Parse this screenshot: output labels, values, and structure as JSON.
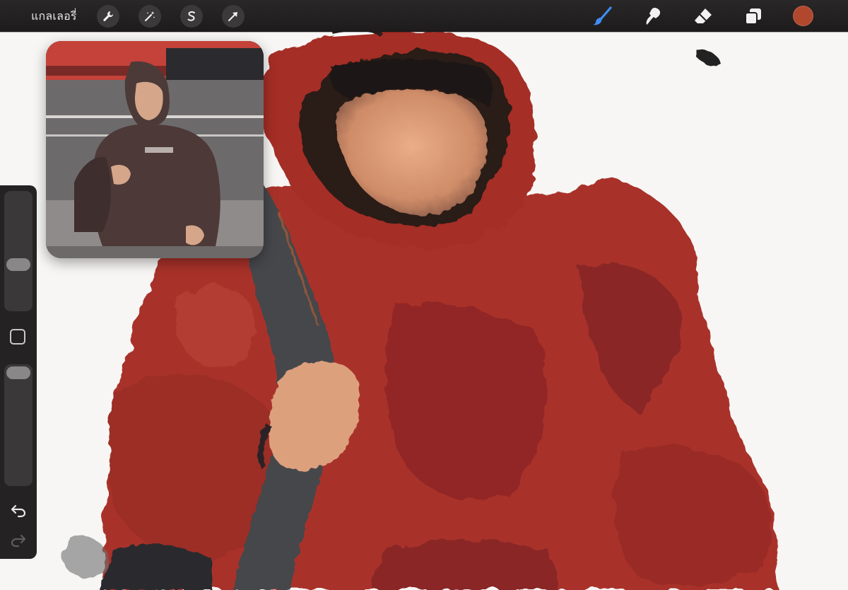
{
  "toolbar": {
    "gallery_label": "แกลเลอรี่",
    "left_tools": [
      "wrench-icon",
      "magic-wand-icon",
      "selection-s-icon",
      "transform-arrow-icon"
    ],
    "right_tools": [
      "brush-icon",
      "smudge-icon",
      "eraser-icon",
      "layers-icon"
    ],
    "active_tool": "brush-icon",
    "active_tool_color": "#3f8df5",
    "current_color": "#b1482e"
  },
  "sidebar": {
    "brush_size_level": 0.37,
    "opacity_level": 1.0,
    "controls": [
      "brush-size-slider",
      "modify-button",
      "opacity-slider",
      "undo-icon",
      "redo-icon"
    ]
  },
  "colors": {
    "hoodie_red": "#a8322a",
    "hoodie_dark": "#7a2224",
    "skin": "#e0a07c",
    "strap_gray": "#4a4a50",
    "canvas_white": "#f7f6f4"
  }
}
